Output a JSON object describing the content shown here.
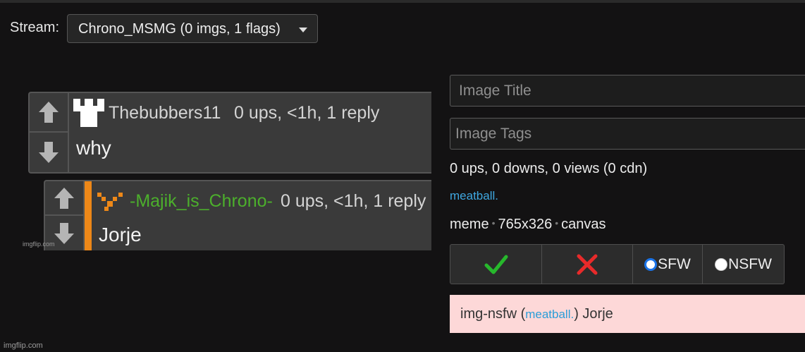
{
  "stream": {
    "label": "Stream:",
    "selected": "Chrono_MSMG (0 imgs, 1 flags)"
  },
  "meme": {
    "comments": [
      {
        "username": "Thebubbers11",
        "meta": "0 ups, <1h, 1 reply",
        "text": "why"
      },
      {
        "username": "-Majik_is_Chrono-",
        "meta": "0 ups, <1h, 1 reply",
        "text": "Jorje"
      }
    ],
    "watermark": "imgflip.com"
  },
  "form": {
    "title_placeholder": "Image Title",
    "tags_placeholder": "Image Tags"
  },
  "stats": "0 ups, 0 downs, 0 views (0 cdn)",
  "uploader": "meatball.",
  "info": {
    "type": "meme",
    "dimensions": "765x326",
    "source": "canvas",
    "separator": "•"
  },
  "buttons": {
    "sfw_label": "SFW",
    "nsfw_label": "NSFW",
    "sfw_selected": true
  },
  "flag": {
    "prefix": "img-nsfw (",
    "user": "meatball.",
    "suffix": ") Jorje"
  },
  "footer_watermark": "imgflip.com",
  "colors": {
    "approve": "#27b82c",
    "reject": "#e82a2a",
    "link": "#3fa7e0",
    "flag_bg": "#fdd8d8",
    "reply_bar": "#ee8818"
  }
}
